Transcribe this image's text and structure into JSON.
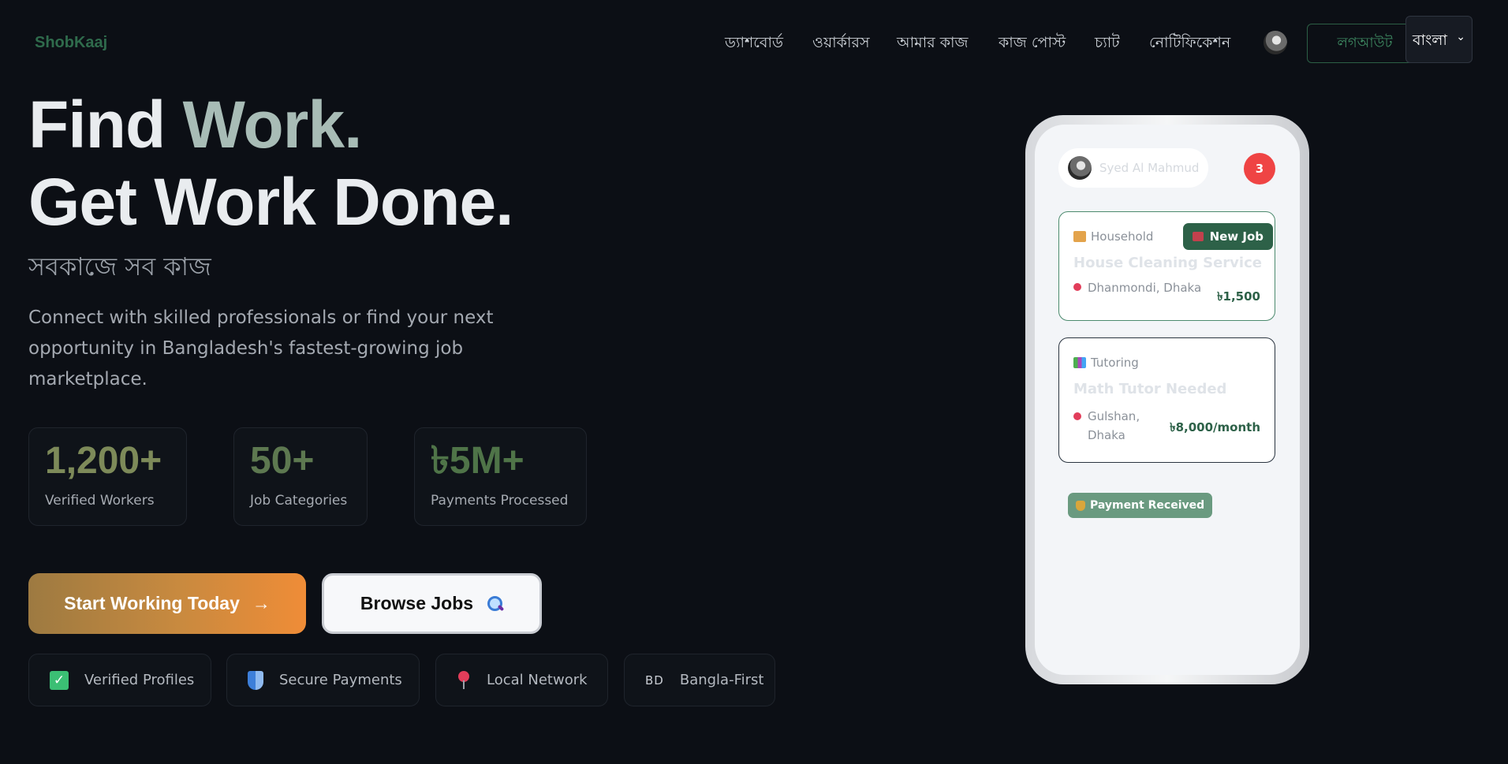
{
  "brand": {
    "name": "ShobKaaj"
  },
  "nav": {
    "links": [
      "ড্যাশবোর্ড",
      "ওয়ার্কারস",
      "আমার কাজ",
      "কাজ পোস্ট",
      "চ্যাট",
      "নোটিফিকেশন"
    ],
    "logout_label": "লগআউট",
    "language": "বাংলা"
  },
  "hero": {
    "line1_a": "Find ",
    "line1_b": "Work.",
    "line2": "Get Work Done.",
    "tagline_bn": "সবকাজে সব কাজ",
    "description": "Connect with skilled professionals or find your next opportunity in Bangladesh's fastest-growing job marketplace."
  },
  "stats": [
    {
      "value": "1,200+",
      "label": "Verified Workers",
      "color": "#7d8a59"
    },
    {
      "value": "50+",
      "label": "Job Categories",
      "color": "#5d7850"
    },
    {
      "value": "৳5M+",
      "label": "Payments Processed",
      "color": "#4f7448"
    }
  ],
  "cta": {
    "start_label": "Start Working Today",
    "start_arrow": "→",
    "browse_label": "Browse Jobs"
  },
  "features": [
    {
      "label": "Verified Profiles",
      "icon": "check-icon"
    },
    {
      "label": "Secure Payments",
      "icon": "shield-icon"
    },
    {
      "label": "Local Network",
      "icon": "pin-icon"
    },
    {
      "label": "Bangla-First",
      "icon": "bd-flag-icon",
      "icon_text": "BD"
    }
  ],
  "phone": {
    "user_name": "Syed Al Mahmud",
    "notification_count": "3",
    "cards": [
      {
        "category": "Household",
        "badge": "New Job",
        "title": "House Cleaning Service",
        "location": "Dhanmondi, Dhaka",
        "price": "৳1,500"
      },
      {
        "category": "Tutoring",
        "title": "Math Tutor Needed",
        "location": "Gulshan, Dhaka",
        "price": "৳8,000/month"
      }
    ],
    "payment_badge": "Payment Received"
  }
}
